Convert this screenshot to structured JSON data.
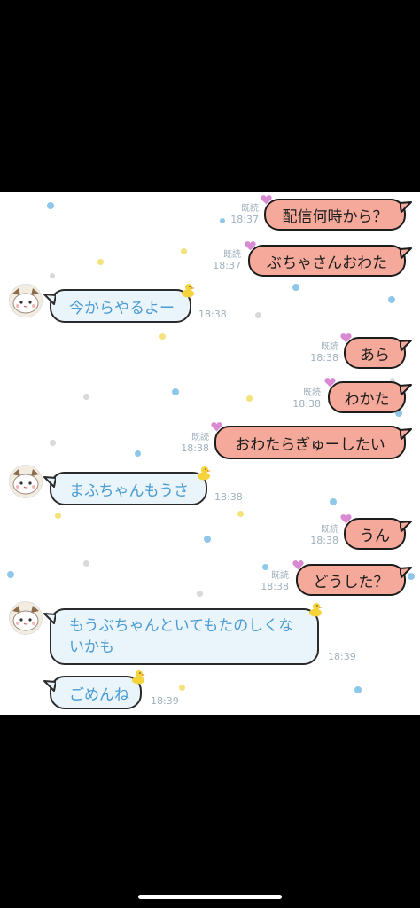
{
  "colors": {
    "sent_bubble": "#f5a99a",
    "received_bubble": "#eaf4fb",
    "received_text": "#4a9bd1",
    "outline": "#1c1c1c",
    "meta_text": "#9fb0bd",
    "background": "#ffffff"
  },
  "messages": [
    {
      "side": "sent",
      "text": "配信何時から？",
      "read": "既読",
      "time": "18:37"
    },
    {
      "side": "sent",
      "text": "ぶちゃさんおわた",
      "read": "既読",
      "time": "18:37"
    },
    {
      "side": "received",
      "text": "今からやるよー",
      "time": "18:38",
      "avatar": true
    },
    {
      "side": "sent",
      "text": "あら",
      "read": "既読",
      "time": "18:38"
    },
    {
      "side": "sent",
      "text": "わかた",
      "read": "既読",
      "time": "18:38"
    },
    {
      "side": "sent",
      "text": "おわたらぎゅーしたい",
      "read": "既読",
      "time": "18:38"
    },
    {
      "side": "received",
      "text": "まふちゃんもうさ",
      "time": "18:38",
      "avatar": true
    },
    {
      "side": "sent",
      "text": "うん",
      "read": "既読",
      "time": "18:38"
    },
    {
      "side": "sent",
      "text": "どうした？",
      "read": "既読",
      "time": "18:38"
    },
    {
      "side": "received",
      "text_lines": [
        "もうぶちゃんといてもたのしくな",
        "いかも"
      ],
      "time": "18:39",
      "avatar": true
    },
    {
      "side": "received",
      "text": "ごめんね",
      "time": "18:39",
      "avatar": false
    }
  ],
  "icons": {
    "sent_decoration": "heart-icon",
    "received_decoration": "duck-icon",
    "avatar": "cat-avatar"
  }
}
